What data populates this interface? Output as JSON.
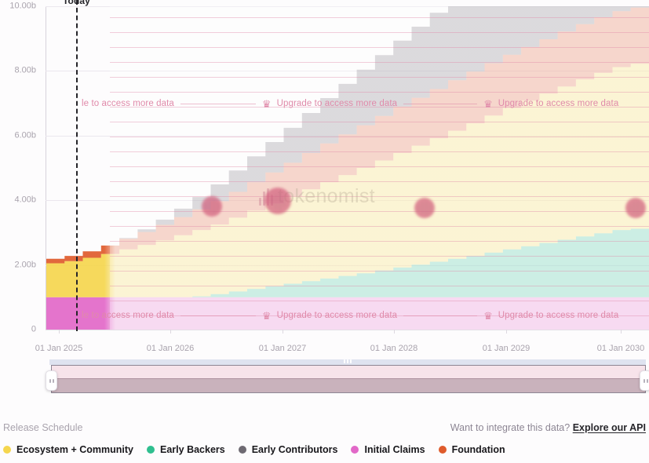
{
  "chart_data": {
    "type": "area",
    "title": "Release Schedule",
    "stacked": true,
    "xlabel": "",
    "ylabel": "",
    "ylim": [
      0,
      10000000000
    ],
    "y_ticks": [
      "0",
      "2.00b",
      "4.00b",
      "6.00b",
      "8.00b",
      "10.00b"
    ],
    "y_tick_values": [
      0,
      2000000000,
      4000000000,
      6000000000,
      8000000000,
      10000000000
    ],
    "x_ticks": [
      "01 Jan 2025",
      "01 Jan 2026",
      "01 Jan 2027",
      "01 Jan 2028",
      "01 Jan 2029",
      "01 Jan 2030"
    ],
    "x_range": [
      "2024-10-15",
      "2030-04-15"
    ],
    "grid": true,
    "legend_position": "bottom",
    "annotations": [
      {
        "label": "Today",
        "type": "vertical-dashed-line",
        "x": "2025-01-20"
      }
    ],
    "series": [
      {
        "name": "Initial Claims",
        "color": "#e268c8",
        "values": [
          1.0,
          1.0,
          1.0,
          1.0,
          1.0,
          1.0,
          1.0,
          1.0,
          1.0,
          1.0,
          1.0,
          1.0,
          1.0,
          1.0,
          1.0,
          1.0,
          1.0,
          1.0,
          1.0,
          1.0,
          1.0,
          1.0,
          1.0,
          1.0,
          1.0,
          1.0,
          1.0,
          1.0,
          1.0,
          1.0,
          1.0,
          1.0,
          1.0,
          1.0
        ]
      },
      {
        "name": "Early Backers",
        "color": "#2fbf8f",
        "values": [
          0.0,
          0.0,
          0.0,
          0.0,
          0.0,
          0.0,
          0.0,
          0.0,
          0.03,
          0.1,
          0.18,
          0.26,
          0.34,
          0.42,
          0.5,
          0.58,
          0.66,
          0.74,
          0.83,
          0.92,
          1.01,
          1.1,
          1.19,
          1.28,
          1.38,
          1.48,
          1.58,
          1.68,
          1.78,
          1.88,
          1.98,
          2.08,
          2.12,
          2.15
        ]
      },
      {
        "name": "Ecosystem + Community",
        "color": "#f5d64e",
        "values": [
          1.05,
          1.12,
          1.22,
          1.34,
          1.48,
          1.62,
          1.76,
          1.92,
          2.05,
          2.15,
          2.28,
          2.42,
          2.56,
          2.7,
          2.84,
          2.98,
          3.12,
          3.26,
          3.4,
          3.54,
          3.68,
          3.82,
          3.96,
          4.1,
          4.24,
          4.38,
          4.5,
          4.62,
          4.74,
          4.86,
          4.96,
          5.04,
          5.1,
          5.14
        ]
      },
      {
        "name": "Foundation",
        "color": "#df5b2c",
        "values": [
          0.14,
          0.16,
          0.2,
          0.26,
          0.33,
          0.4,
          0.48,
          0.56,
          0.64,
          0.72,
          0.8,
          0.88,
          0.96,
          1.04,
          1.12,
          1.2,
          1.26,
          1.32,
          1.38,
          1.44,
          1.48,
          1.52,
          1.56,
          1.6,
          1.62,
          1.64,
          1.66,
          1.68,
          1.7,
          1.71,
          1.72,
          1.73,
          1.74,
          1.75
        ]
      },
      {
        "name": "Early Contributors",
        "color": "#6e6a72",
        "values": [
          0.0,
          0.0,
          0.0,
          0.0,
          0.02,
          0.08,
          0.16,
          0.26,
          0.38,
          0.52,
          0.66,
          0.8,
          0.94,
          1.08,
          1.24,
          1.4,
          1.56,
          1.72,
          1.88,
          2.04,
          2.2,
          2.36,
          2.52,
          2.68,
          2.84,
          3.0,
          3.16,
          3.32,
          3.48,
          3.64,
          3.8,
          3.96,
          4.1,
          4.22
        ]
      }
    ]
  },
  "chart": {
    "today_label": "Today",
    "watermark_text": "tokenomist"
  },
  "upgrade": {
    "crown_icon": "crown-icon",
    "text": "Upgrade to access more data",
    "text_clipped": "le to access more data"
  },
  "range_slider": {
    "name": "date-range-slider",
    "left_handle": "range-handle-left",
    "right_handle": "range-handle-right"
  },
  "footer": {
    "release_schedule_label": "Release Schedule",
    "integrate_text": "Want to integrate this data?",
    "api_link_label": "Explore our API"
  },
  "legend": {
    "items": [
      {
        "label": "Ecosystem + Community",
        "color": "#f5d64e"
      },
      {
        "label": "Early Backers",
        "color": "#2fbf8f"
      },
      {
        "label": "Early Contributors",
        "color": "#6e6a72"
      },
      {
        "label": "Initial Claims",
        "color": "#e268c8"
      },
      {
        "label": "Foundation",
        "color": "#df5b2c"
      }
    ]
  }
}
